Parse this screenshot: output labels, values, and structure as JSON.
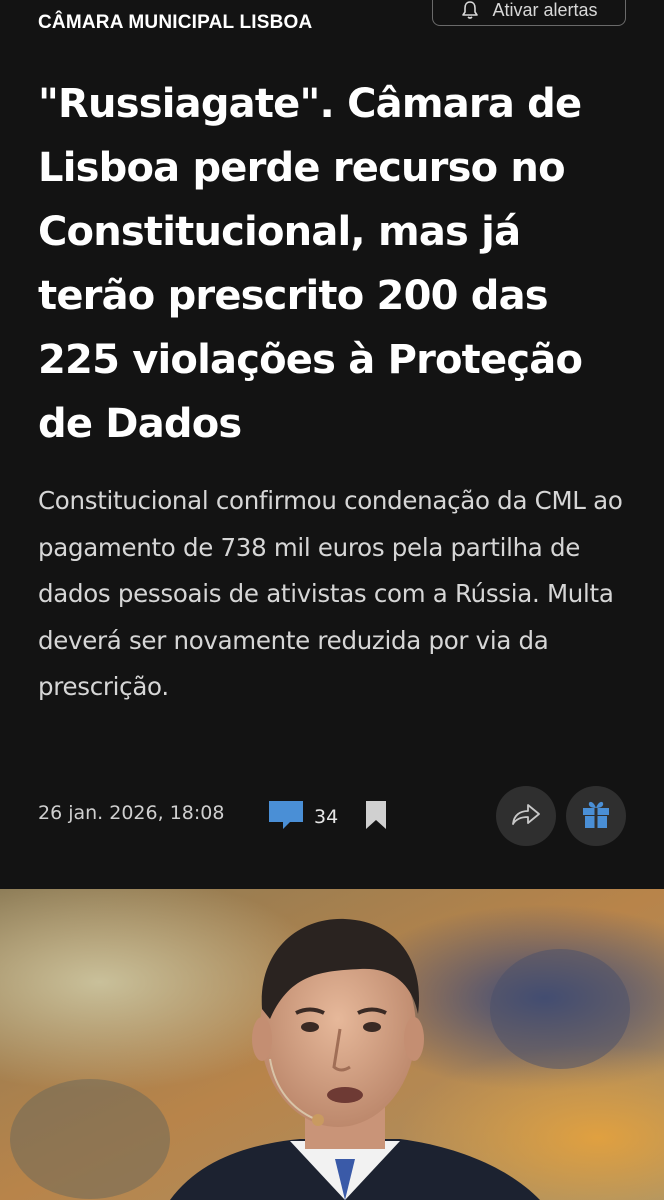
{
  "header": {
    "section_label": "CÂMARA MUNICIPAL LISBOA",
    "alerts_button_label": "Ativar alertas",
    "alerts_icon": "bell-icon"
  },
  "article": {
    "headline": "\"Russiagate\". Câmara de Lisboa perde recurso no Constitucional, mas já terão prescrito 200 das 225 violações à Proteção de Dados",
    "lead": "Constitucional confirmou condenação da CML ao pagamento de 738 mil euros pela partilha de dados pessoais de ativistas com a Rússia. Multa deverá ser novamente reduzida por via da prescrição.",
    "meta": {
      "date": "26 jan. 2026, 18:08",
      "comment_count": "34",
      "comment_icon": "comment-icon",
      "bookmark_icon": "bookmark-icon",
      "share_icon": "share-icon",
      "gift_icon": "gift-icon"
    }
  },
  "colors": {
    "background": "#131313",
    "accent_blue": "#4a8fd6",
    "button_bg": "#2f2f2f"
  }
}
